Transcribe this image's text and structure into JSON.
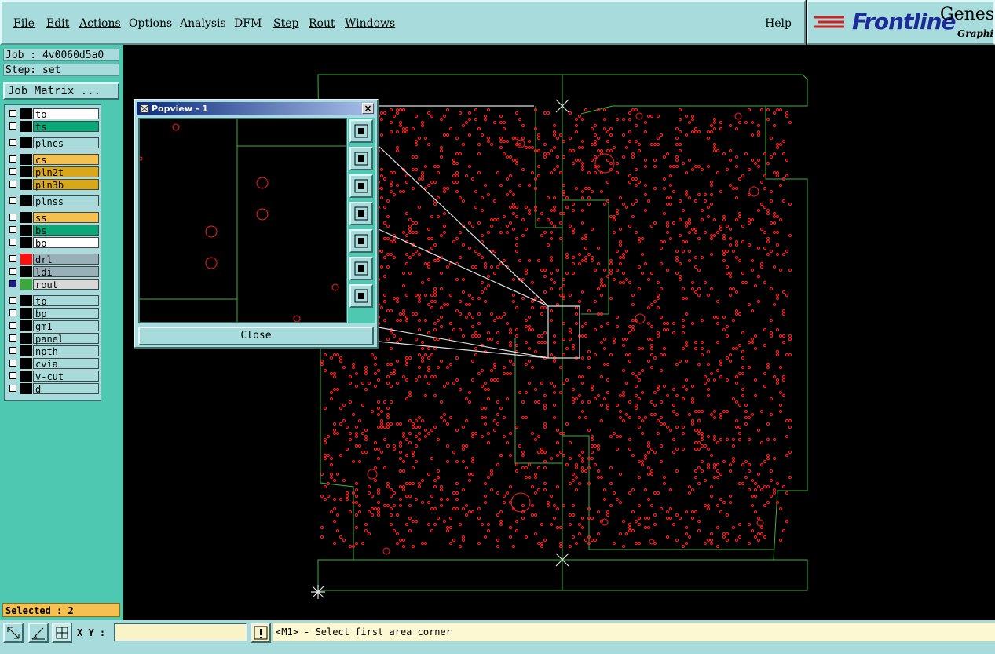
{
  "menubar": {
    "items": [
      {
        "label": "File",
        "underlined": true
      },
      {
        "label": "Edit",
        "underlined": true
      },
      {
        "label": "Actions",
        "underlined": true
      },
      {
        "label": "Options",
        "underlined": false
      },
      {
        "label": "Analysis",
        "underlined": false
      },
      {
        "label": "DFM",
        "underlined": false
      },
      {
        "label": "Step",
        "underlined": true
      },
      {
        "label": "Rout",
        "underlined": true
      },
      {
        "label": "Windows",
        "underlined": true
      }
    ],
    "help": "Help"
  },
  "brand": {
    "logo": "Frontline",
    "product": "Genesi",
    "tagline": "Graphic"
  },
  "sidebar": {
    "job": "Job : 4v0060d5a0",
    "step": "Step: set",
    "job_matrix": "Job Matrix ...",
    "layers": [
      {
        "name": "to",
        "color": "#ffffff",
        "checked": false,
        "swatch": "#000000"
      },
      {
        "name": "ts",
        "color": "#0aa878",
        "checked": false,
        "swatch": "#000000"
      },
      {
        "name": "plncs",
        "color": "#a8dcdc",
        "checked": false,
        "swatch": "#000000"
      },
      {
        "name": "cs",
        "color": "#f4c050",
        "checked": false,
        "swatch": "#000000"
      },
      {
        "name": "pln2t",
        "color": "#d8a818",
        "checked": false,
        "swatch": "#000000"
      },
      {
        "name": "pln3b",
        "color": "#d8a818",
        "checked": false,
        "swatch": "#000000"
      },
      {
        "name": "plnss",
        "color": "#a8dcdc",
        "checked": false,
        "swatch": "#000000"
      },
      {
        "name": "ss",
        "color": "#f4c050",
        "checked": false,
        "swatch": "#000000"
      },
      {
        "name": "bs",
        "color": "#0aa878",
        "checked": false,
        "swatch": "#000000"
      },
      {
        "name": "bo",
        "color": "#ffffff",
        "checked": false,
        "swatch": "#000000"
      },
      {
        "name": "drl",
        "color": "#9ab0b8",
        "checked": false,
        "swatch": "#ff1010"
      },
      {
        "name": "ldi",
        "color": "#9ab0b8",
        "checked": false,
        "swatch": "#000000"
      },
      {
        "name": "rout",
        "color": "#d8d8d8",
        "checked": true,
        "swatch": "#3ca83c"
      },
      {
        "name": "tp",
        "color": "#a8dcdc",
        "checked": false,
        "swatch": "#000000"
      },
      {
        "name": "bp",
        "color": "#a8dcdc",
        "checked": false,
        "swatch": "#000000"
      },
      {
        "name": "gm1",
        "color": "#a8dcdc",
        "checked": false,
        "swatch": "#000000"
      },
      {
        "name": "panel",
        "color": "#a8dcdc",
        "checked": false,
        "swatch": "#000000"
      },
      {
        "name": "npth",
        "color": "#a8dcdc",
        "checked": false,
        "swatch": "#000000"
      },
      {
        "name": "cvia",
        "color": "#a8dcdc",
        "checked": false,
        "swatch": "#000000"
      },
      {
        "name": "v-cut",
        "color": "#a8dcdc",
        "checked": false,
        "swatch": "#000000"
      },
      {
        "name": "d",
        "color": "#a8dcdc",
        "checked": false,
        "swatch": "#000000"
      }
    ],
    "selected": "Selected : 2"
  },
  "popview": {
    "title": "Popview - 1",
    "close": "Close",
    "tools": [
      "zoom-home-icon",
      "pan-up-icon",
      "pan-down-icon",
      "pan-left-icon",
      "pan-right-icon",
      "zoom-in-icon",
      "zoom-out-icon"
    ]
  },
  "statusbar": {
    "xy_label": "X Y :",
    "xy_value": "",
    "message": "<M1> - Select first area corner"
  },
  "colors": {
    "pad": "#ff2020",
    "outline": "#3cb43c",
    "panel_bg": "#a8dcdc",
    "sidebar_bg": "#4ec8b0"
  }
}
